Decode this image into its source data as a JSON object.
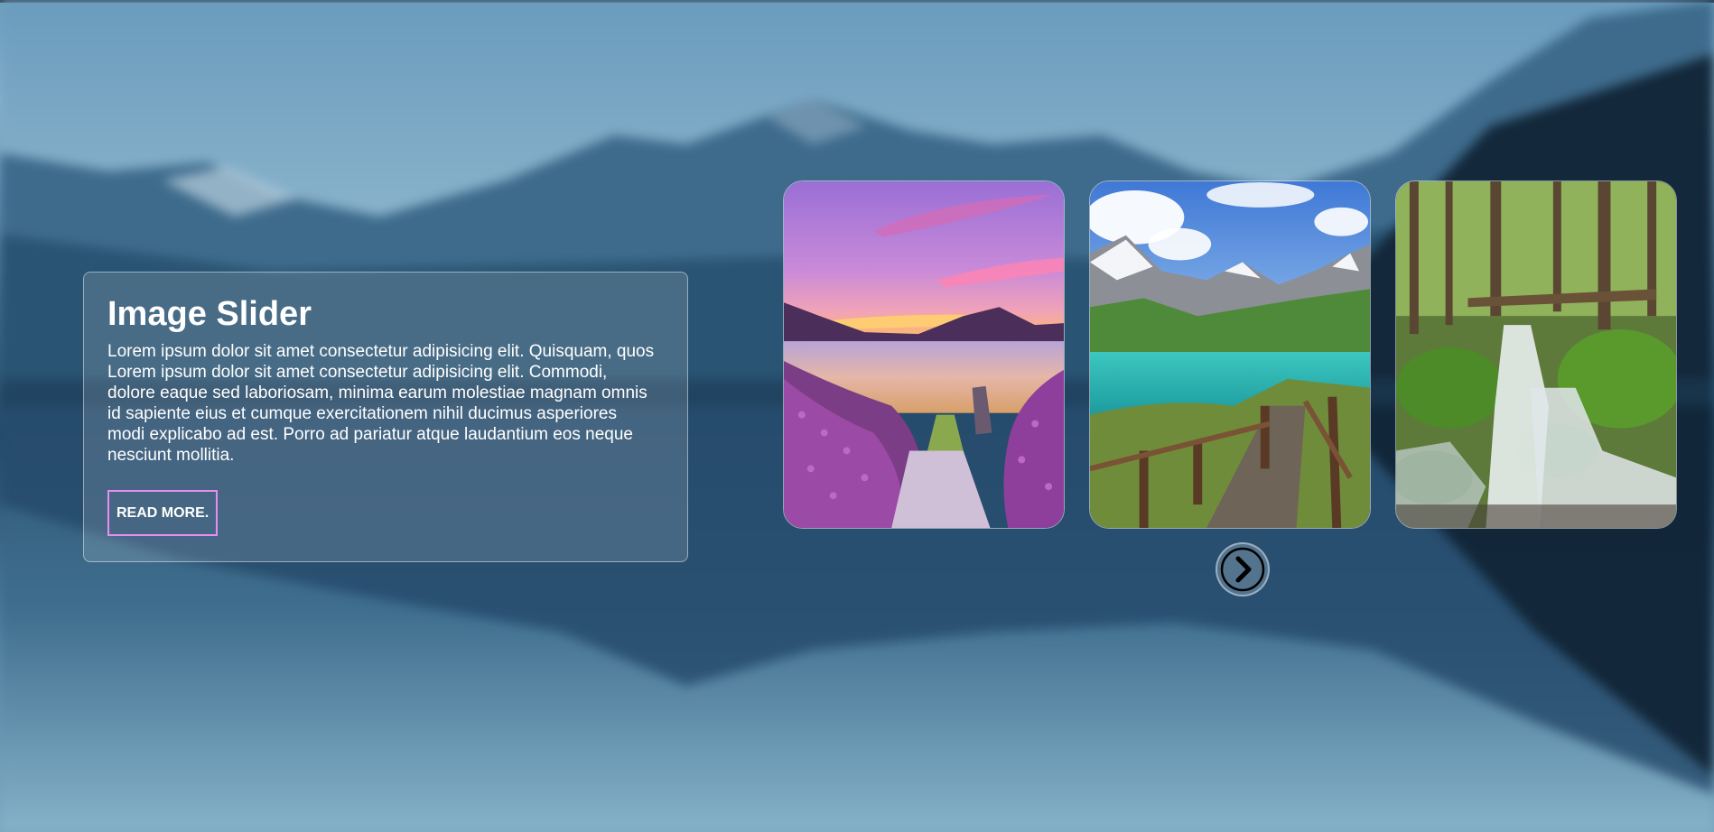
{
  "hero": {
    "title": "Image Slider",
    "body": "Lorem ipsum dolor sit amet consectetur adipisicing elit. Quisquam, quos Lorem ipsum dolor sit amet consectetur adipisicing elit. Commodi, dolore eaque sed laboriosam, minima earum molestiae magnam omnis id sapiente eius et cumque exercitationem nihil ducimus asperiores modi explicabo ad est. Porro ad pariatur atque laudantium eos neque nesciunt mollitia.",
    "button_label": "READ MORE."
  },
  "slides": [
    {
      "subject": "sunset lake with lavender flowers and pier"
    },
    {
      "subject": "turquoise mountain lake with wooden boardwalk"
    },
    {
      "subject": "mossy forest waterfall"
    }
  ],
  "controls": {
    "next_icon": "chevron-right-icon"
  },
  "colors": {
    "button_border": "#e88ef0",
    "text": "#ffffff"
  }
}
